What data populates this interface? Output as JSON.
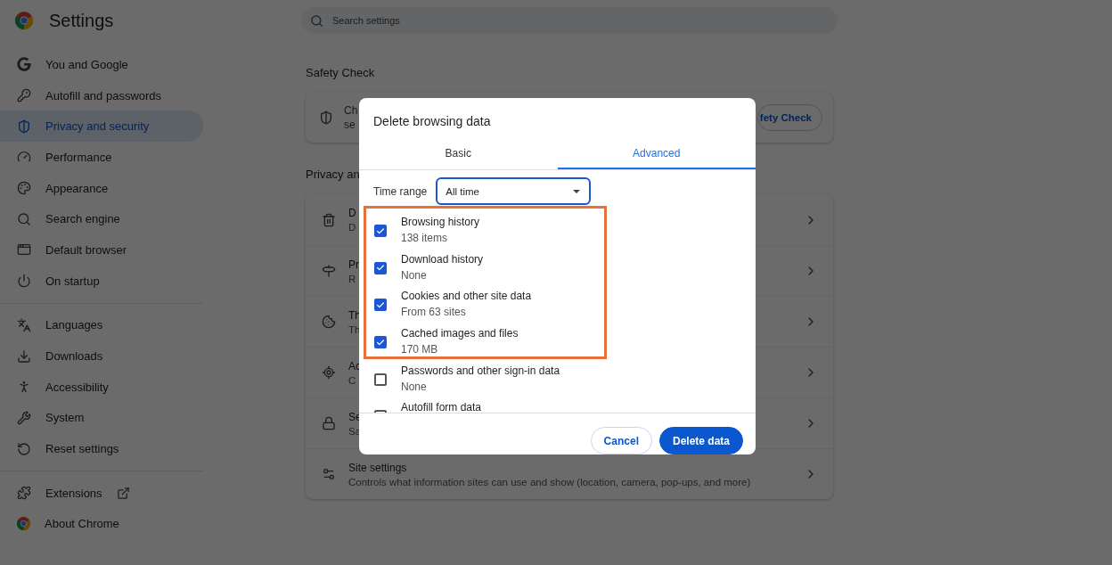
{
  "app": {
    "title": "Settings"
  },
  "search": {
    "placeholder": "Search settings"
  },
  "sidebar": {
    "groups": [
      [
        {
          "label": "You and Google",
          "selected": false
        },
        {
          "label": "Autofill and passwords",
          "selected": false
        },
        {
          "label": "Privacy and security",
          "selected": true
        },
        {
          "label": "Performance",
          "selected": false
        },
        {
          "label": "Appearance",
          "selected": false
        },
        {
          "label": "Search engine",
          "selected": false
        },
        {
          "label": "Default browser",
          "selected": false
        },
        {
          "label": "On startup",
          "selected": false
        }
      ],
      [
        {
          "label": "Languages",
          "selected": false
        },
        {
          "label": "Downloads",
          "selected": false
        },
        {
          "label": "Accessibility",
          "selected": false
        },
        {
          "label": "System",
          "selected": false
        },
        {
          "label": "Reset settings",
          "selected": false
        }
      ],
      [
        {
          "label": "Extensions",
          "selected": false
        },
        {
          "label": "About Chrome",
          "selected": false
        }
      ]
    ]
  },
  "safety_check": {
    "heading": "Safety Check",
    "text_lines": [
      "Ch",
      "se"
    ],
    "button": "fety Check"
  },
  "privacy": {
    "heading": "Privacy an",
    "rows": [
      {
        "title": "D",
        "subtitle": "D"
      },
      {
        "title": "Pr",
        "subtitle": "R"
      },
      {
        "title": "Th",
        "subtitle": "Th"
      },
      {
        "title": "Ac",
        "subtitle": "C"
      },
      {
        "title": "Se",
        "subtitle": "Sa"
      },
      {
        "title": "Site settings",
        "subtitle": "Controls what information sites can use and show (location, camera, pop-ups, and more)"
      }
    ]
  },
  "dialog": {
    "title": "Delete browsing data",
    "tabs": [
      {
        "label": "Basic",
        "selected": false
      },
      {
        "label": "Advanced",
        "selected": true
      }
    ],
    "time_range": {
      "label": "Time range",
      "value": "All time"
    },
    "items": [
      {
        "label": "Browsing history",
        "detail": "138 items",
        "checked": true
      },
      {
        "label": "Download history",
        "detail": "None",
        "checked": true
      },
      {
        "label": "Cookies and other site data",
        "detail": "From 63 sites",
        "checked": true
      },
      {
        "label": "Cached images and files",
        "detail": "170 MB",
        "checked": true
      },
      {
        "label": "Passwords and other sign-in data",
        "detail": "None",
        "checked": false
      },
      {
        "label": "Autofill form data",
        "checked": false
      }
    ],
    "buttons": [
      {
        "label": "Cancel",
        "kind": "secondary"
      },
      {
        "label": "Delete data",
        "kind": "primary"
      }
    ]
  }
}
